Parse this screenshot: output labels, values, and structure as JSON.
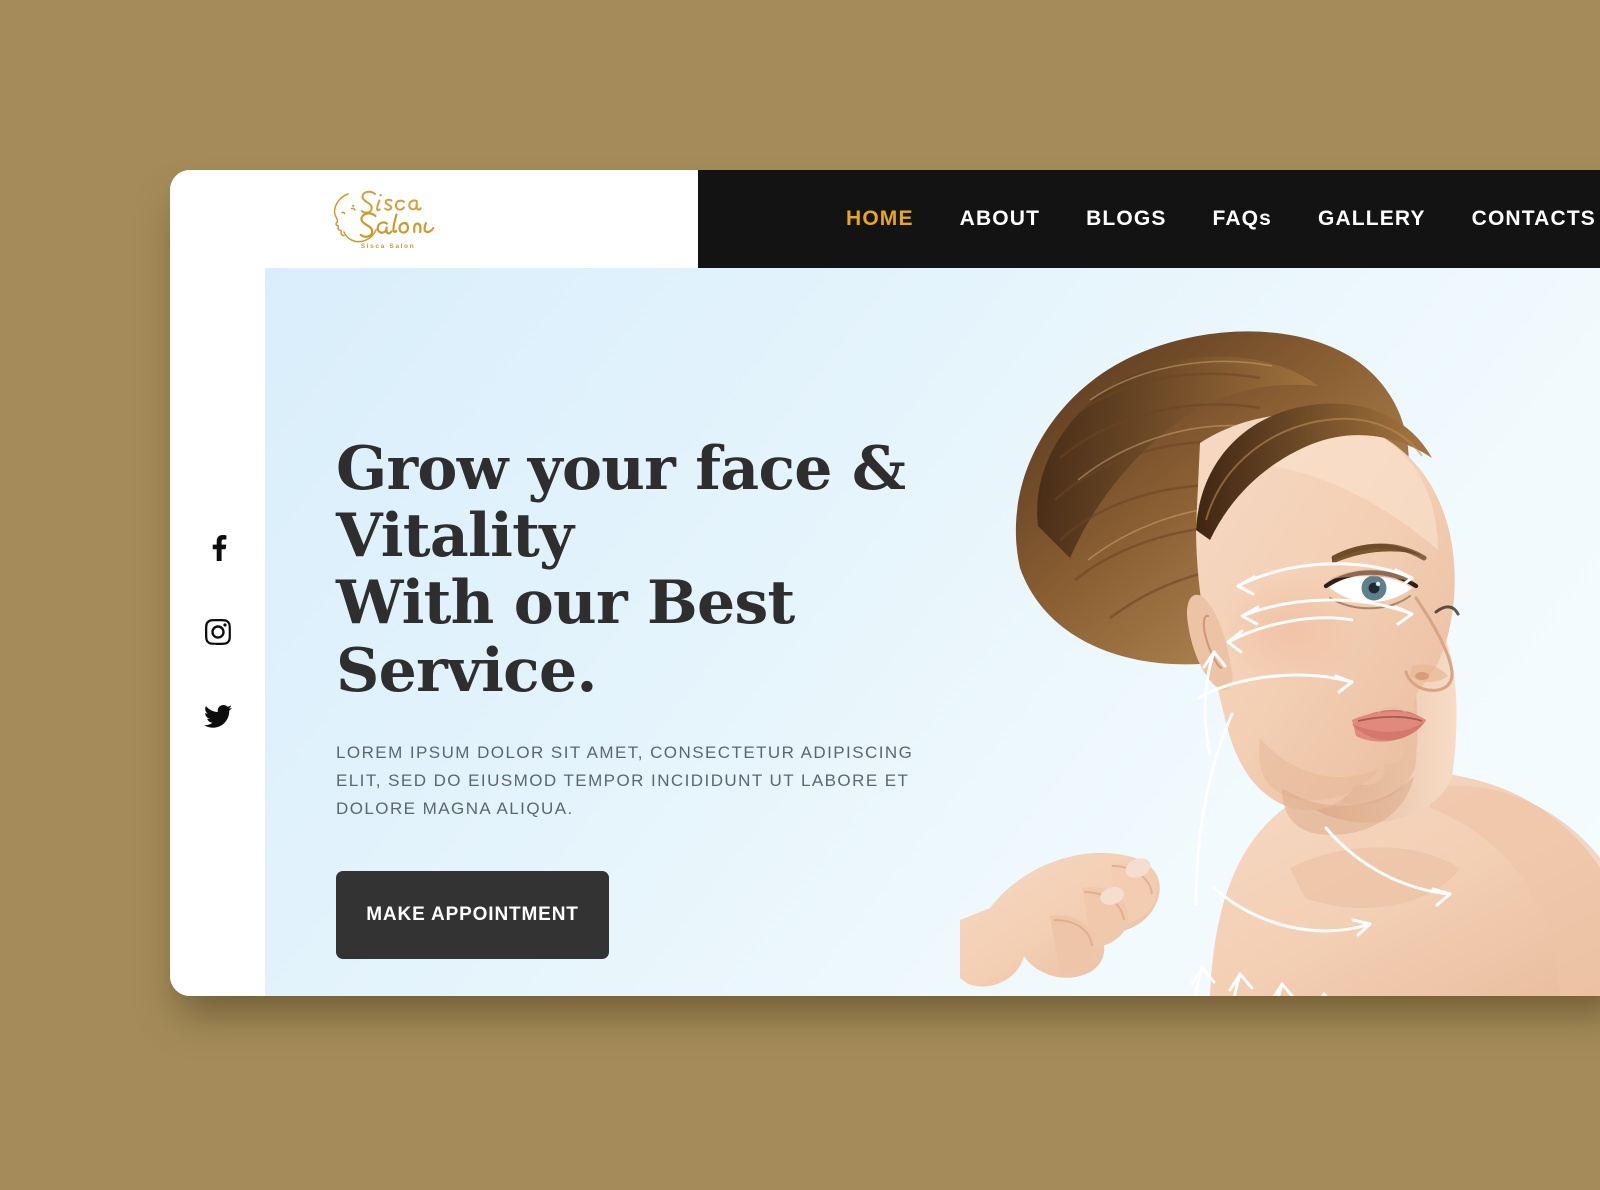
{
  "page": {
    "background_color": "#a48b59",
    "window_background": "#ffffff"
  },
  "header": {
    "logo": {
      "icon_name": "sisca-salon-logo",
      "script_line_1": "Sisca",
      "script_line_2": "Salon",
      "tagline": "Sisca Salon",
      "color": "#d09a2a"
    },
    "nav_background": "#131313",
    "active_color": "#e8a520",
    "nav_items": [
      {
        "label": "HOME",
        "active": true
      },
      {
        "label": "ABOUT",
        "active": false
      },
      {
        "label": "BLOGS",
        "active": false
      },
      {
        "label": "FAQs",
        "active": false
      },
      {
        "label": "GALLERY",
        "active": false
      },
      {
        "label": "CONTACTS",
        "active": false
      }
    ]
  },
  "social_rail": {
    "items": [
      {
        "icon_name": "facebook-icon",
        "label": "Facebook"
      },
      {
        "icon_name": "instagram-icon",
        "label": "Instagram"
      },
      {
        "icon_name": "twitter-icon",
        "label": "Twitter"
      }
    ]
  },
  "hero": {
    "title": "Grow your face & Vitality\nWith our Best Service.",
    "title_color": "#2e2e2e",
    "subtitle": "Lorem ipsum dolor sit amet, consectetur adipiscing elit, sed do eiusmod tempor incididunt ut labore et dolore magna aliqua.",
    "subtitle_color": "#5b6672",
    "cta_label": "MAKE APPOINTMENT",
    "cta_background": "#333333",
    "background_from": "#d9eefb",
    "background_to": "#f6fcfe",
    "photo": {
      "icon_name": "woman-face-profile-photo",
      "description": "Woman in profile with white facial-lifting direction arrows on forehead, cheek and neck"
    }
  }
}
